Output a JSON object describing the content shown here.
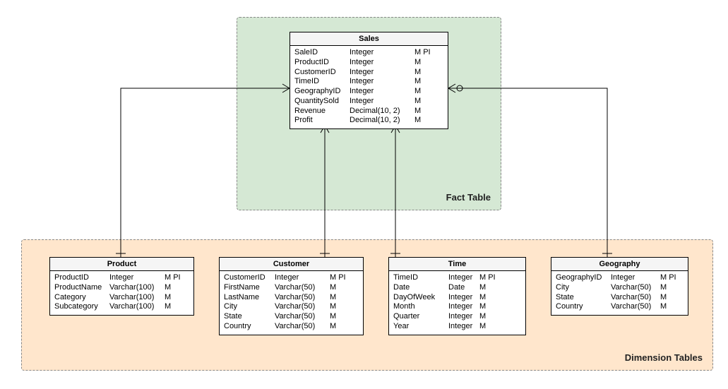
{
  "regions": {
    "fact": {
      "label": "Fact Table"
    },
    "dimension": {
      "label": "Dimension Tables"
    }
  },
  "tables": {
    "sales": {
      "title": "Sales",
      "columns": [
        {
          "name": "SaleID",
          "type": "Integer",
          "flags": "M PI"
        },
        {
          "name": "ProductID",
          "type": "Integer",
          "flags": "M"
        },
        {
          "name": "CustomerID",
          "type": "Integer",
          "flags": "M"
        },
        {
          "name": "TimeID",
          "type": "Integer",
          "flags": "M"
        },
        {
          "name": "GeographyID",
          "type": "Integer",
          "flags": "M"
        },
        {
          "name": "QuantitySold",
          "type": "Integer",
          "flags": "M"
        },
        {
          "name": "Revenue",
          "type": "Decimal(10, 2)",
          "flags": "M"
        },
        {
          "name": "Profit",
          "type": "Decimal(10, 2)",
          "flags": "M"
        }
      ]
    },
    "product": {
      "title": "Product",
      "columns": [
        {
          "name": "ProductID",
          "type": "Integer",
          "flags": "M PI"
        },
        {
          "name": "ProductName",
          "type": "Varchar(100)",
          "flags": "M"
        },
        {
          "name": "Category",
          "type": "Varchar(100)",
          "flags": "M"
        },
        {
          "name": "Subcategory",
          "type": "Varchar(100)",
          "flags": "M"
        }
      ]
    },
    "customer": {
      "title": "Customer",
      "columns": [
        {
          "name": "CustomerID",
          "type": "Integer",
          "flags": "M PI"
        },
        {
          "name": "FirstName",
          "type": "Varchar(50)",
          "flags": "M"
        },
        {
          "name": "LastName",
          "type": "Varchar(50)",
          "flags": "M"
        },
        {
          "name": "City",
          "type": "Varchar(50)",
          "flags": "M"
        },
        {
          "name": "State",
          "type": "Varchar(50)",
          "flags": "M"
        },
        {
          "name": "Country",
          "type": "Varchar(50)",
          "flags": "M"
        }
      ]
    },
    "time": {
      "title": "Time",
      "columns": [
        {
          "name": "TimeID",
          "type": "Integer",
          "flags": "M PI"
        },
        {
          "name": "Date",
          "type": "Date",
          "flags": "M"
        },
        {
          "name": "DayOfWeek",
          "type": "Integer",
          "flags": "M"
        },
        {
          "name": "Month",
          "type": "Integer",
          "flags": "M"
        },
        {
          "name": "Quarter",
          "type": "Integer",
          "flags": "M"
        },
        {
          "name": "Year",
          "type": "Integer",
          "flags": "M"
        }
      ]
    },
    "geography": {
      "title": "Geography",
      "columns": [
        {
          "name": "GeographyID",
          "type": "Integer",
          "flags": "M PI"
        },
        {
          "name": "City",
          "type": "Varchar(50)",
          "flags": "M"
        },
        {
          "name": "State",
          "type": "Varchar(50)",
          "flags": "M"
        },
        {
          "name": "Country",
          "type": "Varchar(50)",
          "flags": "M"
        }
      ]
    }
  },
  "chart_data": {
    "type": "table",
    "model": "Star Schema",
    "fact_table": "Sales",
    "dimension_tables": [
      "Product",
      "Customer",
      "Time",
      "Geography"
    ],
    "relationships": [
      {
        "from": "Product.ProductID",
        "to": "Sales.ProductID",
        "cardinality": "one-to-many"
      },
      {
        "from": "Customer.CustomerID",
        "to": "Sales.CustomerID",
        "cardinality": "one-to-many"
      },
      {
        "from": "Time.TimeID",
        "to": "Sales.TimeID",
        "cardinality": "one-to-many"
      },
      {
        "from": "Geography.GeographyID",
        "to": "Sales.GeographyID",
        "cardinality": "one-to-many"
      }
    ]
  }
}
